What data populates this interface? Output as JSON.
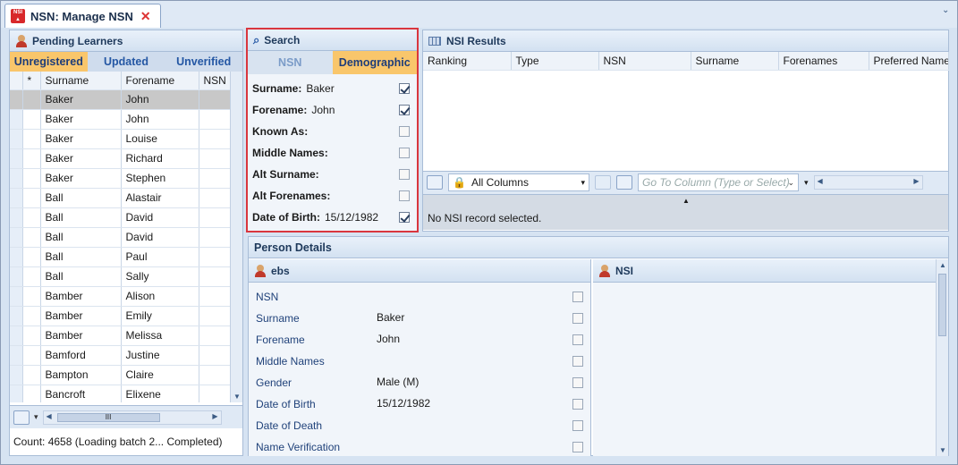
{
  "window": {
    "tab_title": "NSN: Manage NSN",
    "tab_icon": "nsi-logo-icon",
    "close_glyph": "✕"
  },
  "pending": {
    "title": "Pending Learners",
    "tabs": [
      "Unregistered",
      "Updated",
      "Unverified"
    ],
    "active_tab": 0,
    "columns": [
      "*",
      "Surname",
      "Forename",
      "NSN"
    ],
    "rows": [
      [
        "Baker",
        "John"
      ],
      [
        "Baker",
        "John"
      ],
      [
        "Baker",
        "Louise"
      ],
      [
        "Baker",
        "Richard"
      ],
      [
        "Baker",
        "Stephen"
      ],
      [
        "Ball",
        "Alastair"
      ],
      [
        "Ball",
        "David"
      ],
      [
        "Ball",
        "David"
      ],
      [
        "Ball",
        "Paul"
      ],
      [
        "Ball",
        "Sally"
      ],
      [
        "Bamber",
        "Alison"
      ],
      [
        "Bamber",
        "Emily"
      ],
      [
        "Bamber",
        "Melissa"
      ],
      [
        "Bamford",
        "Justine"
      ],
      [
        "Bampton",
        "Claire"
      ],
      [
        "Bancroft",
        "Elixene"
      ]
    ],
    "scroll_grip": "III",
    "status": "Count: 4658 (Loading batch 2... Completed)"
  },
  "search": {
    "title": "Search",
    "tabs": [
      "NSN",
      "Demographic"
    ],
    "active_tab": 1,
    "fields": [
      {
        "label": "Surname:",
        "value": "Baker",
        "checked": true
      },
      {
        "label": "Forename:",
        "value": "John",
        "checked": true
      },
      {
        "label": "Known As:",
        "value": "",
        "checked": false
      },
      {
        "label": "Middle Names:",
        "value": "",
        "checked": false
      },
      {
        "label": "Alt Surname:",
        "value": "",
        "checked": false
      },
      {
        "label": "Alt Forenames:",
        "value": "",
        "checked": false
      },
      {
        "label": "Date of Birth:",
        "value": "15/12/1982",
        "checked": true
      }
    ],
    "highlight_color": "#d9363e"
  },
  "results": {
    "title": "NSI Results",
    "columns": [
      "Ranking",
      "Type",
      "NSN",
      "Surname",
      "Forenames",
      "Preferred Name"
    ],
    "columns_select": "All Columns",
    "goto_placeholder": "Go To Column (Type or Select)",
    "status": "No NSI record selected."
  },
  "person": {
    "title": "Person Details",
    "ebs_title": "ebs",
    "nsi_title": "NSI",
    "fields": [
      {
        "label": "NSN",
        "value": ""
      },
      {
        "label": "Surname",
        "value": "Baker"
      },
      {
        "label": "Forename",
        "value": "John"
      },
      {
        "label": "Middle Names",
        "value": ""
      },
      {
        "label": "Gender",
        "value": "Male (M)"
      },
      {
        "label": "Date of Birth",
        "value": "15/12/1982"
      },
      {
        "label": "Date of Death",
        "value": ""
      },
      {
        "label": "Name Verification",
        "value": ""
      }
    ]
  }
}
